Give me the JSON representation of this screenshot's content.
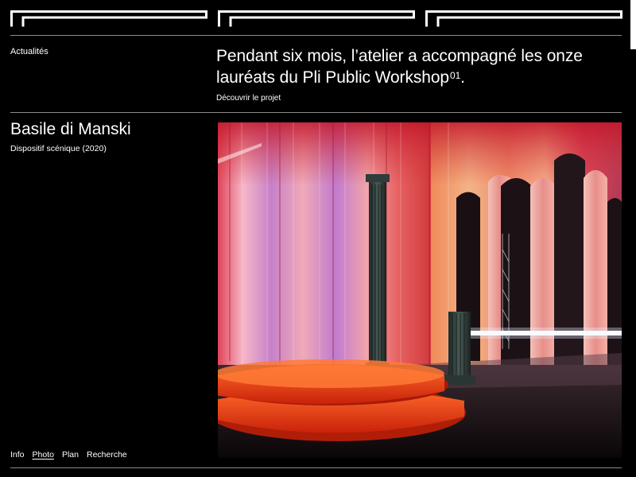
{
  "site": {
    "logo_name": "Pli logo",
    "colors": {
      "background": "#000000",
      "text": "#ffffff",
      "rule": "#8a8a8a"
    }
  },
  "news": {
    "section_label": "Actualités",
    "headline": "Pendant six mois, l’atelier a accompagné les onze lauréats du Pli Public Workshop",
    "headline_sup": "01",
    "headline_end": ".",
    "cta": "Découvrir le projet"
  },
  "project": {
    "artist": "Basile di Manski",
    "work": "Dispositif scénique (2020)",
    "image_subject": "stage-set-photo"
  },
  "nav": {
    "items": [
      {
        "label": "Info",
        "active": false
      },
      {
        "label": "Photo",
        "active": true
      },
      {
        "label": "Plan",
        "active": false
      },
      {
        "label": "Recherche",
        "active": false
      }
    ]
  }
}
